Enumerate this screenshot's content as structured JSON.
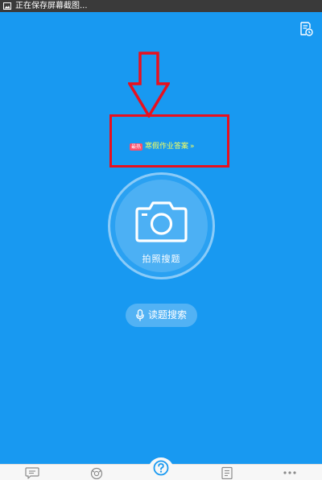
{
  "status_bar": {
    "notification_text": "正在保存屏幕截图..."
  },
  "promo": {
    "badge": "最热",
    "text": "寒假作业答案",
    "chevron": "»"
  },
  "camera_button": {
    "label": "拍照搜题"
  },
  "voice_button": {
    "label": "读题搜索"
  },
  "tabs": [
    {
      "icon": "chat-icon"
    },
    {
      "icon": "explore-icon"
    },
    {
      "icon": "question-icon"
    },
    {
      "icon": "notes-icon"
    },
    {
      "icon": "more-icon"
    }
  ],
  "colors": {
    "background": "#1899f1",
    "annotation": "#e8101e",
    "promo_text": "#f6ff5e",
    "badge": "#ff4f6b",
    "status_bar": "#3a3a3a",
    "tabbar": "#f7f7f7",
    "tab_icon": "#8a8a8a",
    "tab_icon_active": "#1899f1"
  }
}
